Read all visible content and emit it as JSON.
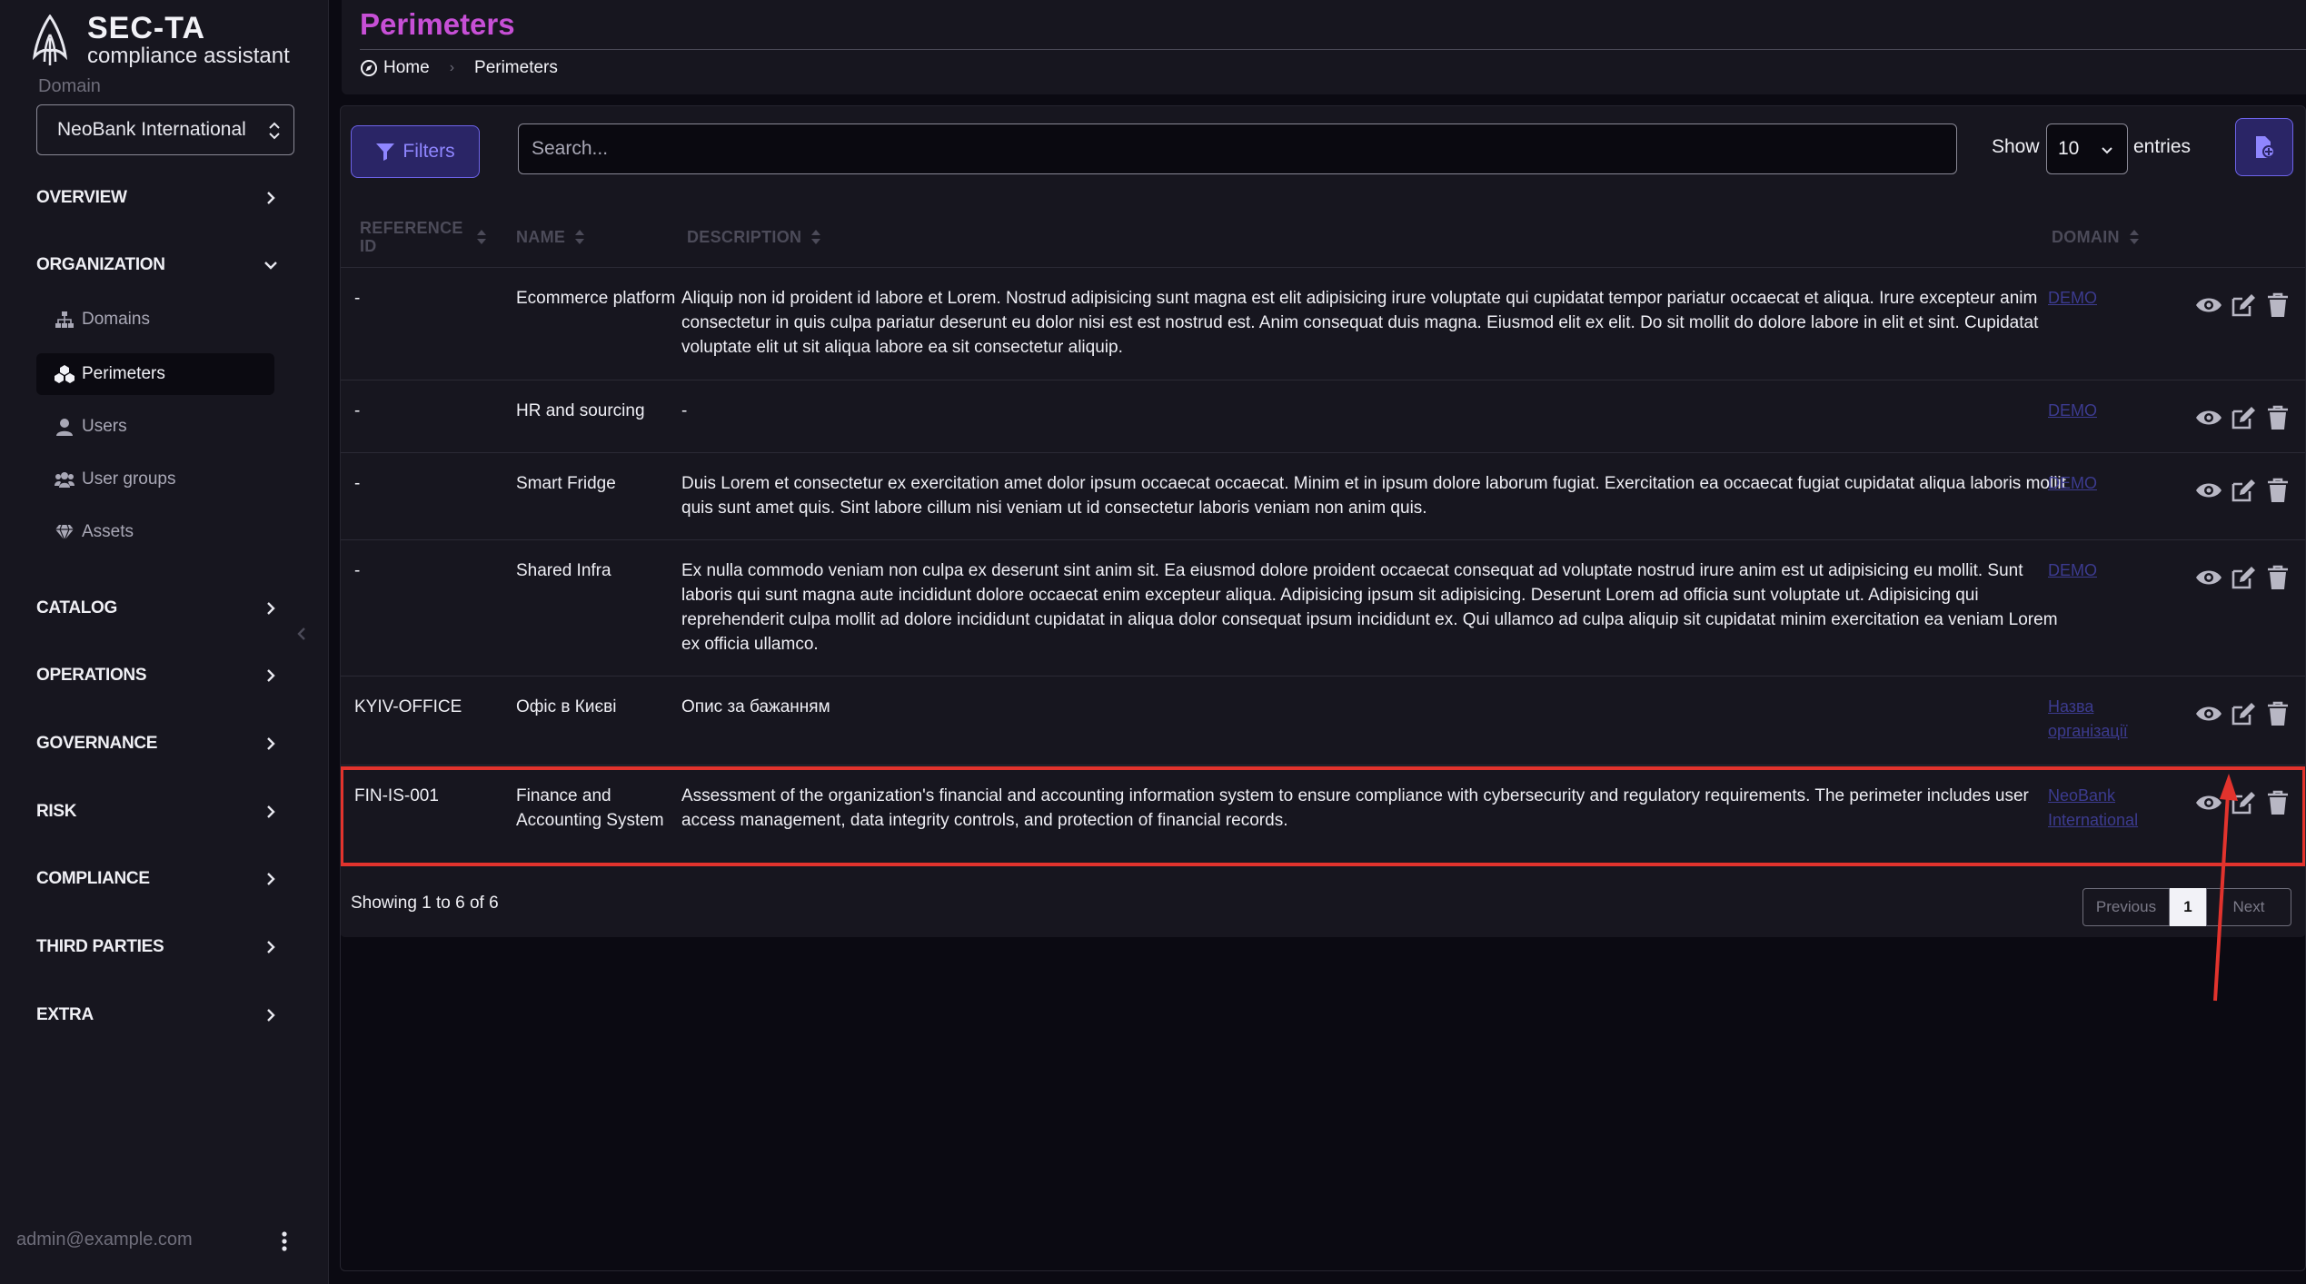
{
  "app": {
    "brand_title": "SEC-TA",
    "brand_subtitle": "compliance assistant"
  },
  "domain": {
    "label": "Domain",
    "selected": "NeoBank International"
  },
  "sidebar": {
    "sections": [
      {
        "label": "OVERVIEW"
      },
      {
        "label": "ORGANIZATION"
      },
      {
        "label": "CATALOG"
      },
      {
        "label": "OPERATIONS"
      },
      {
        "label": "GOVERNANCE"
      },
      {
        "label": "RISK"
      },
      {
        "label": "COMPLIANCE"
      },
      {
        "label": "THIRD PARTIES"
      },
      {
        "label": "EXTRA"
      }
    ],
    "org_items": [
      {
        "label": "Domains",
        "icon": "sitemap-icon"
      },
      {
        "label": "Perimeters",
        "icon": "cubes-icon"
      },
      {
        "label": "Users",
        "icon": "user-icon"
      },
      {
        "label": "User groups",
        "icon": "users-icon"
      },
      {
        "label": "Assets",
        "icon": "gem-icon"
      }
    ],
    "user_email": "admin@example.com"
  },
  "header": {
    "title": "Perimeters",
    "breadcrumb": {
      "home": "Home",
      "current": "Perimeters"
    }
  },
  "toolbar": {
    "filters_label": "Filters",
    "search_placeholder": "Search...",
    "show_label": "Show",
    "entries_value": "10",
    "entries_label": "entries"
  },
  "table": {
    "columns": [
      "REFERENCE ID",
      "NAME",
      "DESCRIPTION",
      "DOMAIN"
    ],
    "rows": [
      {
        "ref": "-",
        "name": "Ecommerce platform",
        "description": "Aliquip non id proident id labore et Lorem. Nostrud adipisicing sunt magna est elit adipisicing irure voluptate qui cupidatat tempor pariatur occaecat et aliqua. Irure excepteur anim consectetur in quis culpa pariatur deserunt eu dolor nisi est est nostrud est. Anim consequat duis magna. Eiusmod elit ex elit. Do sit mollit do dolore labore in elit et sint. Cupidatat voluptate elit ut sit aliqua labore ea sit consectetur aliquip.",
        "domain": "DEMO"
      },
      {
        "ref": "-",
        "name": "HR and sourcing",
        "description": "-",
        "domain": "DEMO"
      },
      {
        "ref": "-",
        "name": "Smart Fridge",
        "description": "Duis Lorem et consectetur ex exercitation amet dolor ipsum occaecat occaecat. Minim et in ipsum dolore laborum fugiat. Exercitation ea occaecat fugiat cupidatat aliqua laboris mollit quis sunt amet quis. Sint labore cillum nisi veniam ut id consectetur laboris veniam non anim quis.",
        "domain": "DEMO"
      },
      {
        "ref": "-",
        "name": "Shared Infra",
        "description": "Ex nulla commodo veniam non culpa ex deserunt sint anim sit. Ea eiusmod dolore proident occaecat consequat ad voluptate nostrud irure anim est ut adipisicing eu mollit. Sunt laboris qui sunt magna aute incididunt dolore occaecat enim excepteur aliqua. Adipisicing ipsum sit adipisicing. Deserunt Lorem ad officia sunt voluptate ut. Adipisicing qui reprehenderit culpa mollit ad dolore incididunt cupidatat in aliqua dolor consequat ipsum incididunt ex. Qui ullamco ad culpa aliquip sit cupidatat minim exercitation ea veniam Lorem ex officia ullamco.",
        "domain": "DEMO"
      },
      {
        "ref": "KYIV-OFFICE",
        "name": "Офіс в Києві",
        "description": "Опис за бажанням",
        "domain": "Назва організації"
      },
      {
        "ref": "FIN-IS-001",
        "name": "Finance and Accounting System",
        "description": "Assessment of the organization's financial and accounting information system to ensure compliance with cybersecurity and regulatory requirements. The perimeter includes user access management, data integrity controls, and protection of financial records.",
        "domain": "NeoBank International"
      }
    ]
  },
  "footer": {
    "showing": "Showing 1 to 6 of 6",
    "prev_label": "Previous",
    "current_page": "1",
    "next_label": "Next"
  },
  "colors": {
    "accent": "#c74fd6",
    "primary": "#6d63e8",
    "highlight": "#e2332d",
    "link": "#3c3b8f"
  }
}
